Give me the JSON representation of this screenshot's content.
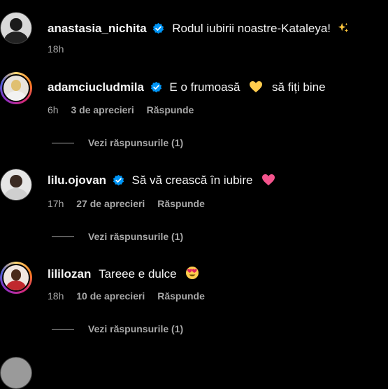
{
  "comments": [
    {
      "username": "anastasia_nichita",
      "verified": true,
      "text": "Rodul iubirii noastre-Kataleya!",
      "emoji": "sparkles",
      "time": "18h",
      "likes": "",
      "reply": ""
    },
    {
      "username": "adamciucludmila",
      "verified": true,
      "text": "E o frumoasă",
      "emoji": "yellow-heart",
      "text2": "să fiți bine",
      "time": "6h",
      "likes": "3 de aprecieri",
      "reply": "Răspunde",
      "view_replies": "Vezi răspunsurile (1)"
    },
    {
      "username": "lilu.ojovan",
      "verified": true,
      "text": "Să vă crească în iubire",
      "emoji": "pink-heart",
      "time": "17h",
      "likes": "27 de aprecieri",
      "reply": "Răspunde",
      "view_replies": "Vezi răspunsurile (1)"
    },
    {
      "username": "lililozan",
      "verified": false,
      "text": "Tareee e dulce",
      "emoji": "heart-eyes-face",
      "time": "18h",
      "likes": "10 de aprecieri",
      "reply": "Răspunde",
      "view_replies": "Vezi răspunsurile (1)"
    }
  ],
  "colors": {
    "background": "#000000",
    "text": "#f5f5f5",
    "muted": "#a8a8a8",
    "verified": "#0095f6"
  }
}
